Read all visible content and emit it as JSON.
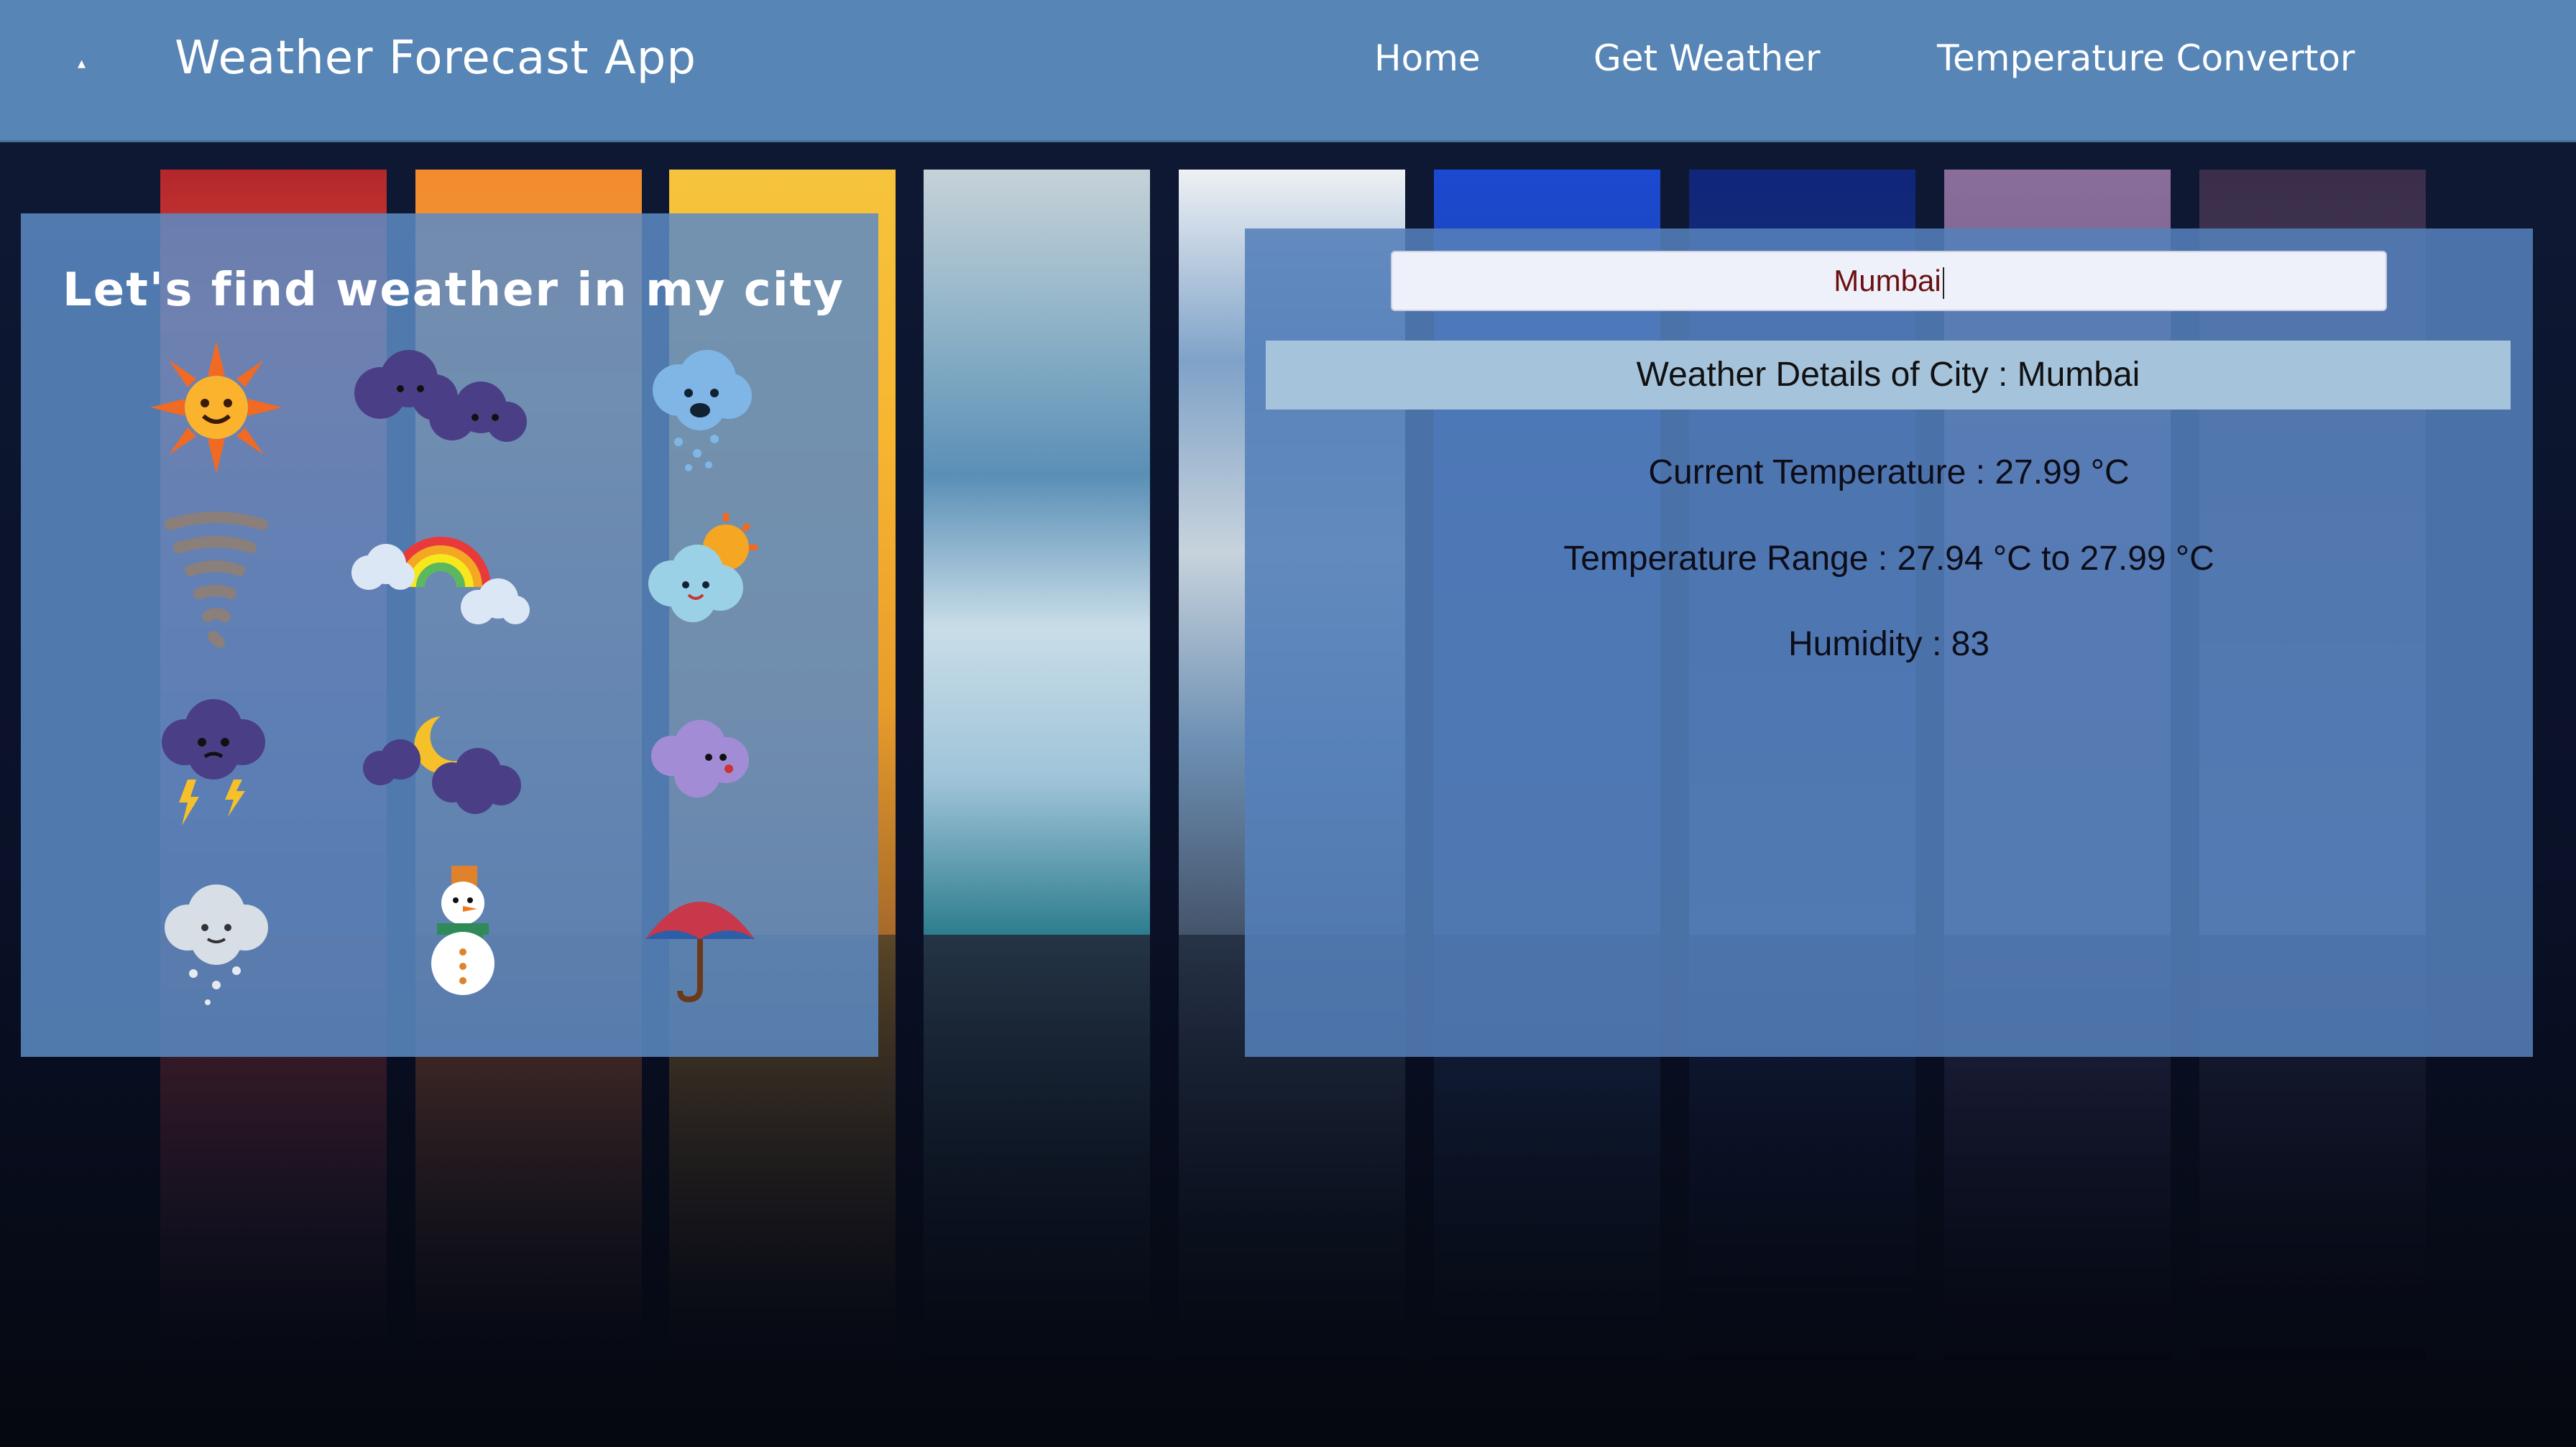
{
  "navbar": {
    "brand": "Weather Forecast App",
    "links": [
      "Home",
      "Get Weather",
      "Temperature Convertor"
    ]
  },
  "left_card": {
    "title": "Let's find weather in my city",
    "icons": [
      "sun-icon",
      "dark-clouds-icon",
      "rain-cloud-icon",
      "tornado-icon",
      "rainbow-clouds-icon",
      "partly-sunny-icon",
      "thunderstorm-icon",
      "night-moon-clouds-icon",
      "wind-cloud-icon",
      "hail-cloud-icon",
      "snowman-icon",
      "umbrella-icon"
    ]
  },
  "search": {
    "value": "Mumbai"
  },
  "weather": {
    "header": "Weather Details of City : Mumbai",
    "current_temp": "Current Temperature : 27.99 °C",
    "temp_range": "Temperature Range : 27.94 °C to 27.99 °C",
    "humidity": "Humidity : 83"
  },
  "colors": {
    "navbar": "#5685b6",
    "card": "#5c8ac4",
    "details_bar": "#a6c3dc"
  }
}
